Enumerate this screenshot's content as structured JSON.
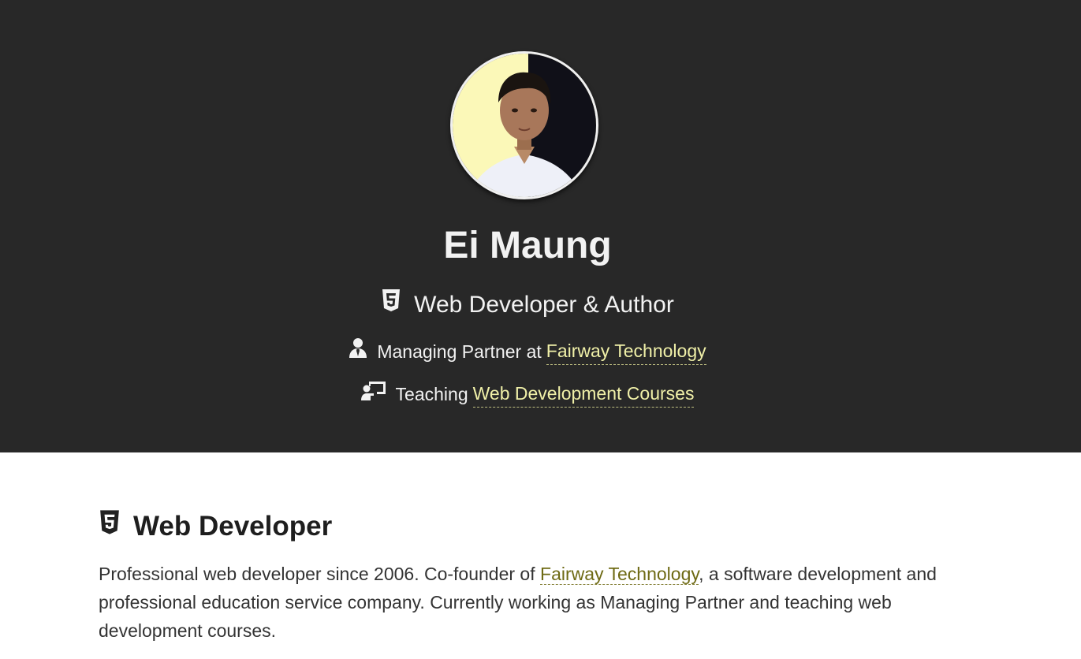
{
  "hero": {
    "name": "Ei Maung",
    "role_icon": "html5-icon",
    "role": "Web Developer & Author",
    "line1": {
      "icon": "user-tie-icon",
      "prefix": "Managing Partner at",
      "link_text": "Fairway Technology"
    },
    "line2": {
      "icon": "chalkboard-teacher-icon",
      "prefix": "Teaching",
      "link_text": "Web Development Courses"
    }
  },
  "section": {
    "icon": "html5-icon",
    "title": "Web Developer",
    "text_before": "Professional web developer since 2006. Co-founder of ",
    "link_text": "Fairway Technology",
    "text_after": ", a software development and professional education service company. Currently working as Managing Partner and teaching web development courses."
  },
  "colors": {
    "hero_bg": "#282828",
    "hero_text": "#f2f2f2",
    "hero_link": "#f0f0a8",
    "body_link": "#6e6a14",
    "body_text": "#333333"
  }
}
